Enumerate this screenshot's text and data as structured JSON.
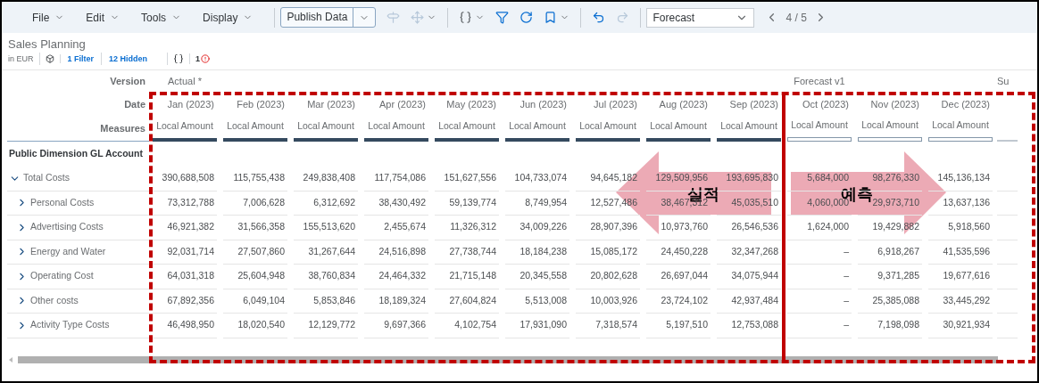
{
  "toolbar": {
    "menus": [
      {
        "label": "File"
      },
      {
        "label": "Edit"
      },
      {
        "label": "Tools"
      },
      {
        "label": "Display"
      }
    ],
    "publish": {
      "label": "Publish Data"
    },
    "tool_groups": [
      [
        {
          "kind": "signpost",
          "disabled": true,
          "dropdown": false
        },
        {
          "kind": "move",
          "disabled": true,
          "dropdown": true
        }
      ],
      [
        {
          "kind": "braces",
          "disabled": false,
          "dropdown": true
        },
        {
          "kind": "filter",
          "disabled": false,
          "dropdown": false
        },
        {
          "kind": "refresh",
          "disabled": false,
          "dropdown": false
        },
        {
          "kind": "bookmark",
          "disabled": false,
          "dropdown": true
        }
      ],
      [
        {
          "kind": "undo",
          "disabled": false,
          "dropdown": false
        },
        {
          "kind": "redo",
          "disabled": true,
          "dropdown": false
        }
      ]
    ],
    "version_select": {
      "value": "Forecast"
    },
    "pager": {
      "position": "4 / 5"
    }
  },
  "header": {
    "title": "Sales Planning",
    "currency": "in EUR",
    "filter_link": "1 Filter",
    "hidden_link": "12 Hidden",
    "error_count": "1"
  },
  "table": {
    "row_header_labels": [
      "Version",
      "Date",
      "Measures"
    ],
    "dimension_label": "Public Dimension GL Account",
    "columns": [
      {
        "kind": "actual",
        "version": "Actual *",
        "date": "Jan (2023)",
        "measure": "Local Amount"
      },
      {
        "kind": "actual",
        "date": "Feb (2023)",
        "measure": "Local Amount"
      },
      {
        "kind": "actual",
        "date": "Mar (2023)",
        "measure": "Local Amount"
      },
      {
        "kind": "actual",
        "date": "Apr (2023)",
        "measure": "Local Amount"
      },
      {
        "kind": "actual",
        "date": "May (2023)",
        "measure": "Local Amount"
      },
      {
        "kind": "actual",
        "date": "Jun (2023)",
        "measure": "Local Amount"
      },
      {
        "kind": "actual",
        "date": "Jul (2023)",
        "measure": "Local Amount"
      },
      {
        "kind": "actual",
        "date": "Aug (2023)",
        "measure": "Local Amount"
      },
      {
        "kind": "actual",
        "date": "Sep (2023)",
        "measure": "Local Amount"
      },
      {
        "kind": "forecast",
        "version": "Forecast v1",
        "date": "Oct (2023)",
        "measure": "Local Amount"
      },
      {
        "kind": "forecast",
        "date": "Nov (2023)",
        "measure": "Local Amount"
      },
      {
        "kind": "forecast",
        "date": "Dec (2023)",
        "measure": "Local Amount"
      },
      {
        "kind": "partial",
        "version": "Su"
      }
    ],
    "rows": [
      {
        "label": "Total Costs",
        "expanded": true,
        "values": [
          "390,688,508",
          "115,755,438",
          "249,838,408",
          "117,754,086",
          "151,627,556",
          "104,733,074",
          "94,645,182",
          "129,509,956",
          "193,695,830",
          "5,684,000",
          "98,276,330",
          "145,136,134"
        ],
        "children": [
          {
            "label": "Personal Costs",
            "expanded": false,
            "values": [
              "73,312,788",
              "7,006,628",
              "6,312,692",
              "38,430,492",
              "59,139,774",
              "8,749,954",
              "12,527,486",
              "38,467,312",
              "45,035,510",
              "4,060,000",
              "29,973,710",
              "13,637,136"
            ]
          },
          {
            "label": "Advertising Costs",
            "expanded": false,
            "values": [
              "46,921,382",
              "31,566,358",
              "155,513,620",
              "2,455,674",
              "11,326,312",
              "34,009,226",
              "28,907,396",
              "10,973,760",
              "26,546,536",
              "1,624,000",
              "19,429,882",
              "5,918,560"
            ]
          },
          {
            "label": "Energy and Water",
            "expanded": false,
            "values": [
              "92,031,714",
              "27,507,860",
              "31,267,644",
              "24,516,898",
              "27,738,744",
              "18,184,238",
              "15,085,172",
              "24,450,228",
              "32,347,268",
              "–",
              "6,918,267",
              "41,535,596"
            ]
          },
          {
            "label": "Operating Cost",
            "expanded": false,
            "values": [
              "64,031,318",
              "25,604,948",
              "38,760,834",
              "24,464,332",
              "21,715,148",
              "20,345,558",
              "20,802,628",
              "26,697,044",
              "34,075,944",
              "–",
              "9,371,285",
              "19,677,616"
            ]
          },
          {
            "label": "Other costs",
            "expanded": false,
            "values": [
              "67,892,356",
              "6,049,104",
              "5,853,846",
              "18,189,324",
              "27,604,824",
              "5,513,008",
              "10,003,926",
              "23,724,102",
              "42,937,484",
              "–",
              "25,385,088",
              "33,445,292"
            ]
          },
          {
            "label": "Activity Type Costs",
            "expanded": false,
            "values": [
              "46,498,950",
              "18,020,540",
              "12,129,772",
              "9,697,366",
              "4,102,754",
              "17,931,090",
              "7,318,574",
              "5,197,510",
              "12,753,088",
              "–",
              "7,198,098",
              "30,921,934"
            ]
          }
        ]
      }
    ]
  },
  "annotations": [
    {
      "kind": "left_arrow",
      "label": "실적"
    },
    {
      "kind": "right_arrow",
      "label": "예측"
    }
  ]
}
